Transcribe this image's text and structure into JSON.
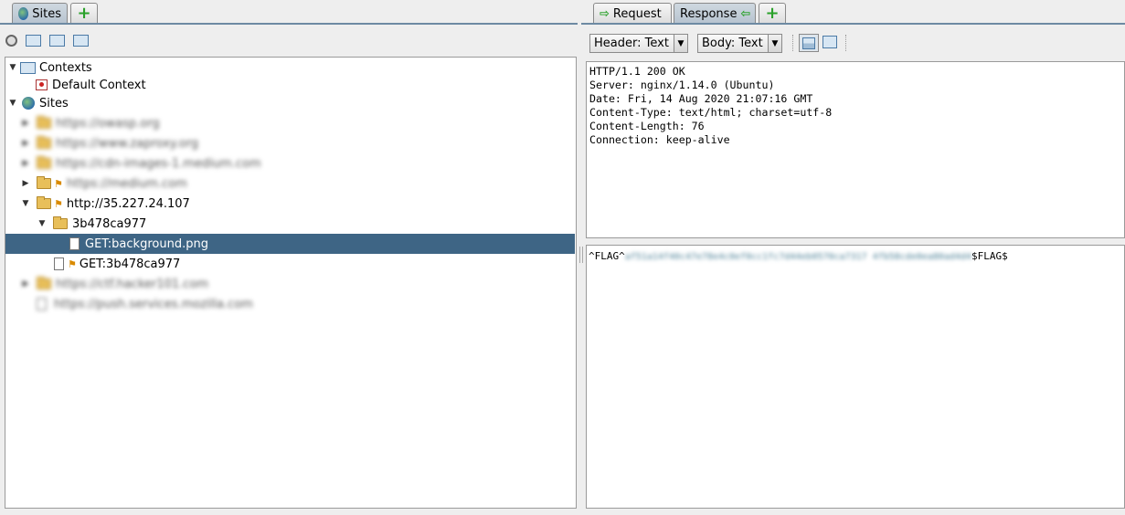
{
  "left_tabs": {
    "sites": "Sites"
  },
  "right_tabs": {
    "request": "Request",
    "response": "Response"
  },
  "tree": {
    "contexts_label": "Contexts",
    "default_context": "Default Context",
    "sites_label": "Sites",
    "blurred_sites": [
      "https://owasp.org",
      "https://www.zaproxy.org",
      "https://cdn-images-1.medium.com",
      "https://medium.com"
    ],
    "host": "http://35.227.24.107",
    "folder": "3b478ca977",
    "selected_item": "GET:background.png",
    "item2": "GET:3b478ca977",
    "blurred_sites_after": [
      "https://ctf.hacker101.com",
      "https://push.services.mozilla.com"
    ]
  },
  "response": {
    "header_dropdown": "Header: Text",
    "body_dropdown": "Body: Text",
    "header_lines": [
      "HTTP/1.1 200 OK",
      "Server: nginx/1.14.0 (Ubuntu)",
      "Date: Fri, 14 Aug 2020 21:07:16 GMT",
      "Content-Type: text/html; charset=utf-8",
      "Content-Length: 76",
      "Connection: keep-alive"
    ],
    "body_prefix": "^FLAG^",
    "body_blurred": "af51a14f40c47e78e4c0ef0cc1fc7d44eb0570ca7317 4fb58cde0ea80ad4d4",
    "body_suffix": "$FLAG$"
  }
}
